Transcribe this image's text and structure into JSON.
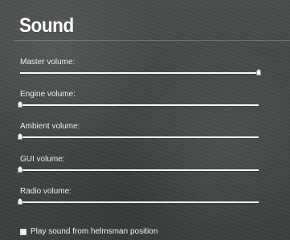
{
  "title": "Sound",
  "settings": [
    {
      "id": "master",
      "label": "Master volume:",
      "value": 1.0
    },
    {
      "id": "engine",
      "label": "Engine volume:",
      "value": 0.0
    },
    {
      "id": "ambient",
      "label": "Ambient volume:",
      "value": 0.0
    },
    {
      "id": "gui",
      "label": "GUI volume:",
      "value": 0.0
    },
    {
      "id": "radio",
      "label": "Radio volume:",
      "value": 0.0
    }
  ],
  "checkbox": {
    "label": "Play sound from helmsman position",
    "checked": false
  }
}
